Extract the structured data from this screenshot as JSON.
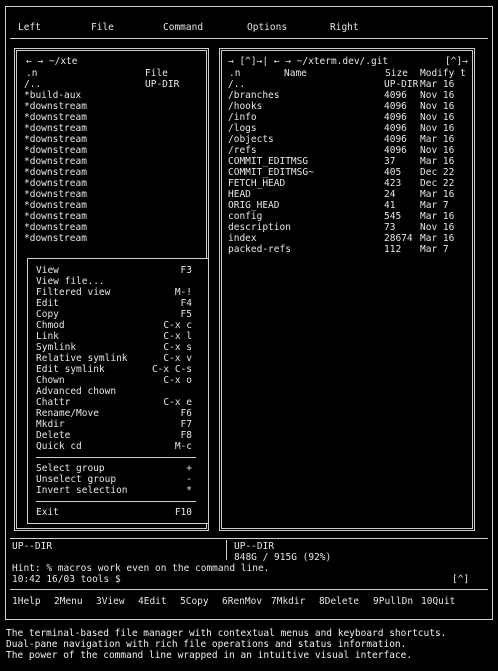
{
  "menubar": [
    "Left",
    "File",
    "Command",
    "Options",
    "Right"
  ],
  "left_panel": {
    "title": "← → ~/xte",
    "columns": [
      ".n",
      "File"
    ],
    "rows": [
      {
        "name": "/..",
        "info": "UP-DIR"
      },
      {
        "name": "*build-aux",
        "info": ""
      },
      {
        "name": "*downstream",
        "info": ""
      },
      {
        "name": "*downstream",
        "info": ""
      },
      {
        "name": "*downstream",
        "info": ""
      },
      {
        "name": "*downstream",
        "info": ""
      },
      {
        "name": "*downstream",
        "info": ""
      },
      {
        "name": "*downstream",
        "info": ""
      },
      {
        "name": "*downstream",
        "info": ""
      },
      {
        "name": "*downstream",
        "info": ""
      },
      {
        "name": "*downstream",
        "info": ""
      },
      {
        "name": "*downstream",
        "info": ""
      },
      {
        "name": "*downstream",
        "info": ""
      },
      {
        "name": "*downstream",
        "info": ""
      },
      {
        "name": "*downstream",
        "info": ""
      }
    ]
  },
  "right_panel": {
    "title": "→ [^]→| ← → ~/xterm.dev/.git",
    "corner": "[^]→",
    "columns": [
      ".n",
      "Name",
      "Size",
      "Modify t"
    ],
    "rows": [
      {
        "name": "/..",
        "size": "UP-DIR",
        "date": "Mar 16"
      },
      {
        "name": "/branches",
        "size": "4096",
        "date": "Nov 16"
      },
      {
        "name": "/hooks",
        "size": "4096",
        "date": "Nov 16"
      },
      {
        "name": "/info",
        "size": "4096",
        "date": "Nov 16"
      },
      {
        "name": "/logs",
        "size": "4096",
        "date": "Nov 16"
      },
      {
        "name": "/objects",
        "size": "4096",
        "date": "Mar 16"
      },
      {
        "name": "/refs",
        "size": "4096",
        "date": "Nov 16"
      },
      {
        "name": "COMMIT_EDITMSG",
        "size": "37",
        "date": "Mar 16"
      },
      {
        "name": "COMMIT_EDITMSG~",
        "size": "405",
        "date": "Dec 22"
      },
      {
        "name": "FETCH_HEAD",
        "size": "423",
        "date": "Dec 22"
      },
      {
        "name": "HEAD",
        "size": "24",
        "date": "Mar 16"
      },
      {
        "name": "ORIG_HEAD",
        "size": "41",
        "date": "Mar 7"
      },
      {
        "name": "config",
        "size": "545",
        "date": "Mar 16"
      },
      {
        "name": "description",
        "size": "73",
        "date": "Nov 16"
      },
      {
        "name": "index",
        "size": "28674",
        "date": "Mar 16"
      },
      {
        "name": "packed-refs",
        "size": "112",
        "date": "Mar 7"
      }
    ]
  },
  "file_menu": {
    "group1": [
      {
        "label": "View",
        "key": "F3"
      },
      {
        "label": "View file...",
        "key": ""
      },
      {
        "label": "Filtered view",
        "key": "M-!"
      },
      {
        "label": "Edit",
        "key": "F4"
      },
      {
        "label": "Copy",
        "key": "F5"
      },
      {
        "label": "Chmod",
        "key": "C-x c"
      },
      {
        "label": "Link",
        "key": "C-x l"
      },
      {
        "label": "Symlink",
        "key": "C-x s"
      },
      {
        "label": "Relative symlink",
        "key": "C-x v"
      },
      {
        "label": "Edit symlink",
        "key": "C-x C-s"
      },
      {
        "label": "Chown",
        "key": "C-x o"
      },
      {
        "label": "Advanced chown",
        "key": ""
      },
      {
        "label": "Chattr",
        "key": "C-x e"
      },
      {
        "label": "Rename/Move",
        "key": "F6"
      },
      {
        "label": "Mkdir",
        "key": "F7"
      },
      {
        "label": "Delete",
        "key": "F8"
      },
      {
        "label": "Quick cd",
        "key": "M-c"
      }
    ],
    "group2": [
      {
        "label": "Select group",
        "key": "+"
      },
      {
        "label": "Unselect group",
        "key": "-"
      },
      {
        "label": "Invert selection",
        "key": "*"
      }
    ],
    "group3": [
      {
        "label": "Exit",
        "key": "F10"
      }
    ]
  },
  "status": {
    "left_info": "UP--DIR",
    "right_info": "UP--DIR",
    "disk": "848G / 915G (92%)"
  },
  "hint": "Hint: % macros work even on the command line.",
  "prompt": "10:42 16/03 tools $",
  "prompt_corner": "[^]",
  "fkeys": [
    {
      "num": "1",
      "label": "Help"
    },
    {
      "num": "2",
      "label": "Menu"
    },
    {
      "num": "3",
      "label": "View"
    },
    {
      "num": "4",
      "label": "Edit"
    },
    {
      "num": "5",
      "label": "Copy"
    },
    {
      "num": "6",
      "label": "RenMov"
    },
    {
      "num": "7",
      "label": "Mkdir"
    },
    {
      "num": "8",
      "label": "Delete"
    },
    {
      "num": "9",
      "label": "PullDn"
    },
    {
      "num": "10",
      "label": "Quit"
    }
  ],
  "captions": [
    "The terminal-based file manager with contextual menus and keyboard shortcuts.",
    "Dual-pane navigation with rich file operations and status information.",
    "The power of the command line wrapped in an intuitive visual interface."
  ]
}
